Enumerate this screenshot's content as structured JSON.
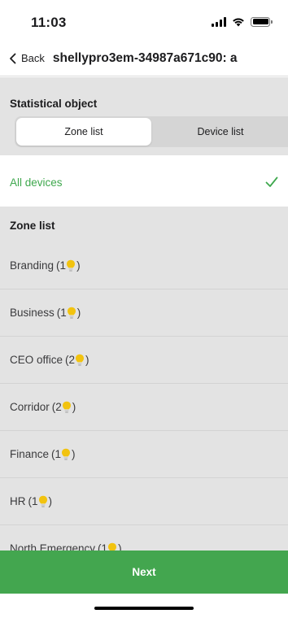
{
  "status_bar": {
    "time": "11:03"
  },
  "nav": {
    "back_label": "Back",
    "title": "shellypro3em-34987a671c90: a"
  },
  "statistical": {
    "header": "Statistical object",
    "segments": [
      {
        "label": "Zone list",
        "active": true
      },
      {
        "label": "Device list",
        "active": false
      }
    ]
  },
  "all_devices": {
    "label": "All devices",
    "selected": true
  },
  "zone_list": {
    "header": "Zone list",
    "items": [
      {
        "name": "Branding",
        "count": "1"
      },
      {
        "name": "Business",
        "count": "1"
      },
      {
        "name": "CEO office",
        "count": "2"
      },
      {
        "name": "Corridor",
        "count": "2"
      },
      {
        "name": "Finance",
        "count": "1"
      },
      {
        "name": "HR",
        "count": "1"
      },
      {
        "name": "North Emergency",
        "count": "1"
      }
    ]
  },
  "next_button": {
    "label": "Next"
  },
  "colors": {
    "accent": "#43a64f",
    "selected_text": "#3fa84e",
    "bulb": "#f2c30f"
  }
}
